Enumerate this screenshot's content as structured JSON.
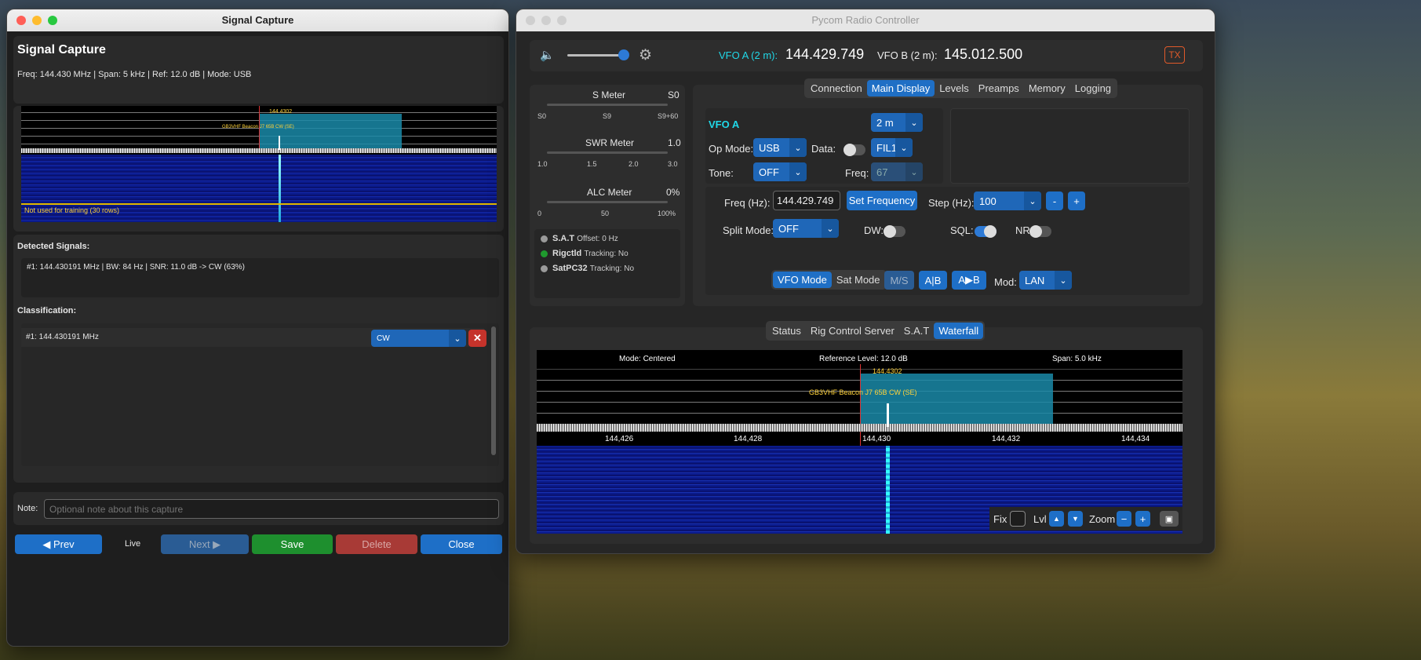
{
  "left": {
    "window_title": "Signal Capture",
    "heading": "Signal Capture",
    "info": "Freq: 144.430 MHz | Span: 5 kHz | Ref: 12.0 dB | Mode: USB",
    "wf_marker": "144.4302",
    "wf_beacon": "GB3VHF Beacon J7 65B CW (SE)",
    "wf_note": "Not used for training (30 rows)",
    "detected_label": "Detected Signals:",
    "detected_text": "#1: 144.430191 MHz | BW: 84 Hz | SNR: 11.0 dB -> CW (63%)",
    "classification_label": "Classification:",
    "class_row_freq": "#1: 144.430191 MHz",
    "class_row_value": "CW",
    "note_label": "Note:",
    "note_placeholder": "Optional note about this capture",
    "prev": "◀ Prev",
    "live": "Live",
    "next": "Next ▶",
    "save": "Save",
    "delete": "Delete",
    "close": "Close"
  },
  "right": {
    "window_title": "Pycom Radio Controller",
    "vfo_a_label": "VFO A (2 m):",
    "vfo_a_freq": "144.429.749",
    "vfo_b_label": "VFO B (2 m):",
    "vfo_b_freq": "145.012.500",
    "tx": "TX",
    "volume_level": 0.95,
    "meters": {
      "s_title": "S Meter",
      "s_val": "S0",
      "s_ticks": [
        "S0",
        "S9",
        "S9+60"
      ],
      "swr_title": "SWR Meter",
      "swr_val": "1.0",
      "swr_ticks": [
        "1.0",
        "1.5",
        "2.0",
        "3.0"
      ],
      "alc_title": "ALC Meter",
      "alc_val": "0%",
      "alc_ticks": [
        "0",
        "50",
        "100%"
      ]
    },
    "integrations": [
      {
        "name": "S.A.T",
        "detail": "Offset: 0 Hz",
        "color": "#9a9a9a"
      },
      {
        "name": "Rigctld",
        "detail": "Tracking: No",
        "color": "#1f9a2e"
      },
      {
        "name": "SatPC32",
        "detail": "Tracking: No",
        "color": "#9a9a9a"
      }
    ],
    "top_tabs": [
      "Connection",
      "Main Display",
      "Levels",
      "Preamps",
      "Memory",
      "Logging"
    ],
    "top_active": "Main Display",
    "vfo_title": "VFO A",
    "band": "2 m",
    "op_mode_label": "Op Mode:",
    "op_mode": "USB",
    "data_label": "Data:",
    "filter": "FIL1",
    "tone_label": "Tone:",
    "tone": "OFF",
    "freq_label": "Freq:",
    "tone_freq": "67",
    "freq_hz_label": "Freq (Hz):",
    "freq_hz_value": "144.429.749",
    "set_freq": "Set Frequency",
    "step_label": "Step (Hz):",
    "step": "100",
    "minus": "-",
    "plus": "+",
    "split_label": "Split Mode:",
    "split": "OFF",
    "dw_label": "DW:",
    "sql_label": "SQL:",
    "nr_label": "NR:",
    "vfo_mode": "VFO Mode",
    "sat_mode": "Sat Mode",
    "ms": "M/S",
    "ab": "A|B",
    "atob": "A▶B",
    "mod_label": "Mod:",
    "mod": "LAN",
    "bottom_tabs": [
      "Status",
      "Rig Control Server",
      "S.A.T",
      "Waterfall"
    ],
    "bottom_active": "Waterfall",
    "wf_mode": "Mode: Centered",
    "wf_ref": "Reference Level: 12.0 dB",
    "wf_span": "Span: 5.0 kHz",
    "wf_marker": "144.4302",
    "wf_beacon": "GB3VHF Beacon J7 65B CW (SE)",
    "wf_ticks": [
      "144,426",
      "144,428",
      "144,430",
      "144,432",
      "144,434"
    ],
    "fix_label": "Fix",
    "lvl_label": "Lvl",
    "zoom_label": "Zoom"
  }
}
